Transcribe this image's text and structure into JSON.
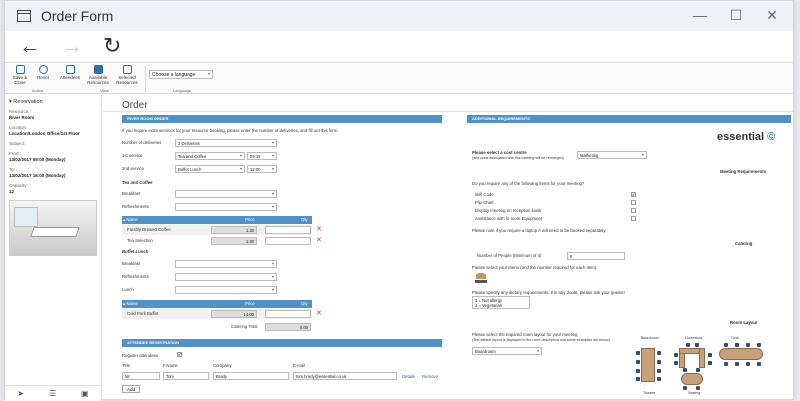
{
  "window": {
    "title": "Order Form",
    "minimize": "—",
    "maximize": "☐",
    "close": "✕"
  },
  "nav": {
    "back": "←",
    "forward": "→",
    "refresh": "↻"
  },
  "ribbon": {
    "save_close": "Save & Close",
    "reset": "Reset",
    "attendees": "Attendees",
    "available_resources": "Available Resources",
    "selected_resources": "Selected Resources",
    "group_action": "Action",
    "group_view": "View",
    "group_language": "Language",
    "language_select": "Choose a language"
  },
  "left": {
    "section": "Reservation",
    "fields": [
      {
        "label": "Resource:",
        "value": "River Room"
      },
      {
        "label": "Location:",
        "value": "Location/London Office/1st Floor"
      },
      {
        "label": "Subject:",
        "value": ""
      },
      {
        "label": "From:",
        "value": "13/02/2017 09:00 (Monday)"
      },
      {
        "label": "To:",
        "value": "13/02/2017 16:00 (Monday)"
      },
      {
        "label": "Capacity:",
        "value": "12"
      }
    ],
    "bottom_icons": [
      "navigate-icon",
      "list-icon",
      "image-icon"
    ],
    "bottom_glyphs": [
      "➤",
      "☰",
      "▣"
    ]
  },
  "order": {
    "heading": "Order",
    "river_bar": "RIVER ROOM ORDER",
    "intro": "If you require extra services for your resource booking, please enter the number of deliveries, and fill out this form.",
    "num_deliveries_label": "Number of deliveries",
    "num_deliveries_value": "2 Deliveries",
    "first_service_label": "1st service",
    "first_service_value": "Tea and Coffee",
    "first_service_time": "09:15",
    "second_service_label": "2nd service",
    "second_service_value": "Buffet Lunch",
    "second_service_time": "12:00",
    "tea_heading": "Tea and Coffee",
    "breakfast_label": "Breakfast",
    "refreshments_label": "Refreshments",
    "col_name": "Name",
    "col_price": "Price",
    "col_qty": "Qty",
    "tea_items": [
      {
        "name": "Freshly Brewed Coffee",
        "price": "1.30"
      },
      {
        "name": "Tea Selection",
        "price": "1.30"
      }
    ],
    "buffet_heading": "Buffet Lunch",
    "lunch_label": "Lunch",
    "buffet_items": [
      {
        "name": "Cold Pork Buffet",
        "price": "14.00"
      }
    ],
    "catering_total_label": "Catering Total",
    "catering_total_value": "0.00"
  },
  "attendee": {
    "bar": "ATTENDEE REGISTRATION",
    "register_label": "Register attendees",
    "col_title": "Title",
    "col_fname": "F.Name",
    "col_company": "Company",
    "col_email": "E-mail",
    "row": {
      "title": "Mr",
      "fname": "Tom",
      "company": "Brady",
      "email": "tom.brady@essential.co.uk"
    },
    "details": "Details",
    "remove": "Remove",
    "add": "Add"
  },
  "requirements": {
    "bar": "ADDITIONAL REQUIREMENTS",
    "logo": "essential",
    "logo_mark": "©",
    "cost_centre_label": "Please select a cost centre",
    "cost_centre_note": "(any costs associated with this meeting will be recharged)",
    "cost_centre_value": "Marketing",
    "meeting_req_heading": "Meeting Requirements",
    "items_question": "Do you require any of the following items for your meeting?",
    "items": [
      {
        "label": "Wifi Code",
        "checked": true
      },
      {
        "label": "Flip Chart",
        "checked": false
      },
      {
        "label": "Display meeting on reception kiosk",
        "checked": false
      },
      {
        "label": "Assistance with in-room Equipment",
        "checked": false
      }
    ],
    "laptop_note": "Please note if you require a laptop it will need to be booked separately.",
    "catering_heading": "Catering",
    "people_label": "Number of People (Minimum of 4)",
    "people_value": "6",
    "menu_label": "Please select your menu (and the number required for each item):",
    "dietary_label": "Please specify any dietary requirements; if in any doubt, please ask your guests!",
    "dietary_lines": [
      "1 = Nut allergy",
      "2 = Vegetarian"
    ],
    "room_layout_heading": "Room Layout",
    "layout_label": "Please select the required room layout for your meeting",
    "layout_note": "(The default layout is displayed in the room description and some examples are below)",
    "layout_value": "Boardroom",
    "layout_types": [
      "Boardroom",
      "Horseshoe",
      "Oval",
      "Theatre",
      "Seating"
    ]
  },
  "colors": {
    "accent": "#4f91c9",
    "remove": "#dd3333"
  }
}
